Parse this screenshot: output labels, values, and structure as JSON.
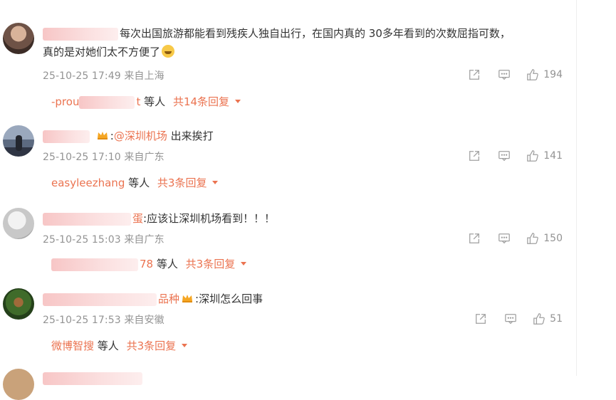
{
  "comments": [
    {
      "name_tail": "",
      "text": "每次出国旅游都能看到残疾人独自出行，在国内真的 30多年看到的次数屈指可数，",
      "text2": "真的是对她们太不方便了",
      "time": "25-10-25 17:49",
      "location": "来自上海",
      "likes": "194",
      "replies": {
        "who": "-prou",
        "who_tail": "t",
        "label": "等人",
        "total": "共14条回复"
      }
    },
    {
      "name_tail": "",
      "text": ":",
      "mention": "@深圳机场",
      "text_after": " 出来挨打",
      "time": "25-10-25 17:10",
      "location": "来自广东",
      "likes": "141",
      "replies": {
        "who": "easyleezhang",
        "label": "等人",
        "total": "共3条回复"
      }
    },
    {
      "name_tail": "蛋",
      "text": ":应该让深圳机场看到！！！",
      "time": "25-10-25 15:03",
      "location": "来自广东",
      "likes": "150",
      "replies": {
        "who_tail": "78",
        "label": "等人",
        "total": "共3条回复"
      }
    },
    {
      "name_tail": "品种",
      "text": ":深圳怎么回事",
      "time": "25-10-25 17:53",
      "location": "来自安徽",
      "likes": "51",
      "replies": {
        "who": "微博智搜",
        "label": "等人",
        "total": "共3条回复"
      }
    }
  ],
  "icons": {
    "share": "share-icon",
    "comment": "comment-icon",
    "like": "thumbs-up-icon",
    "crown": "crown-badge-icon",
    "caret": "caret-down-icon"
  },
  "colors": {
    "link": "#eb7350",
    "meta": "#939393",
    "text": "#333333"
  }
}
